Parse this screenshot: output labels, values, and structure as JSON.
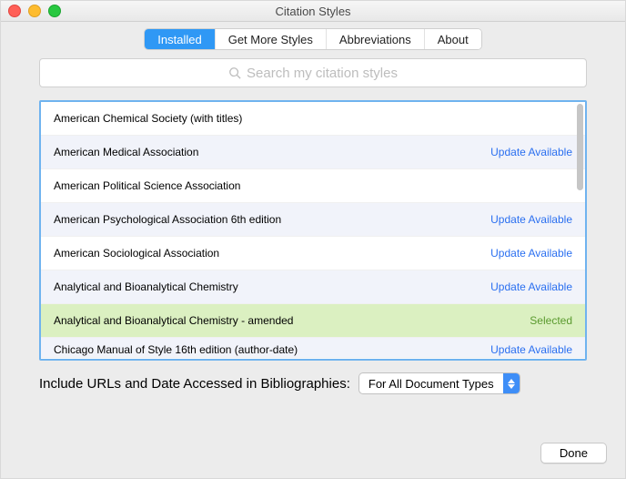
{
  "window": {
    "title": "Citation Styles"
  },
  "tabs": {
    "installed": "Installed",
    "get_more": "Get More Styles",
    "abbrev": "Abbreviations",
    "about": "About"
  },
  "search": {
    "placeholder": "Search my citation styles"
  },
  "rows": [
    {
      "name": "American Chemical Society (with titles)",
      "status": ""
    },
    {
      "name": "American Medical Association",
      "status": "Update Available"
    },
    {
      "name": "American Political Science Association",
      "status": ""
    },
    {
      "name": "American Psychological Association 6th edition",
      "status": "Update Available"
    },
    {
      "name": "American Sociological Association",
      "status": "Update Available"
    },
    {
      "name": "Analytical and Bioanalytical Chemistry",
      "status": "Update Available"
    },
    {
      "name": "Analytical and Bioanalytical Chemistry - amended",
      "status": "Selected"
    },
    {
      "name": "Chicago Manual of Style 16th edition (author-date)",
      "status": "Update Available"
    }
  ],
  "bottom": {
    "label": "Include URLs and Date Accessed in Bibliographies:",
    "select_value": "For All Document Types"
  },
  "buttons": {
    "done": "Done"
  }
}
